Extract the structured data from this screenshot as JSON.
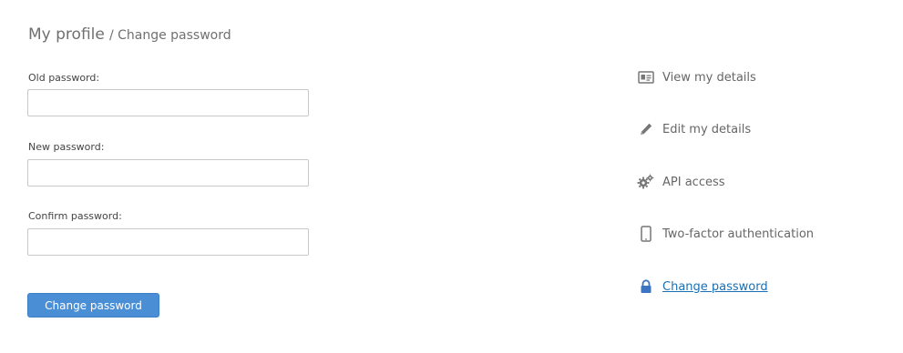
{
  "header": {
    "title": "My profile",
    "subtitle": "/ Change password"
  },
  "form": {
    "fields": [
      {
        "label": "Old password:",
        "value": "",
        "placeholder": ""
      },
      {
        "label": "New password:",
        "value": "",
        "placeholder": ""
      },
      {
        "label": "Confirm password:",
        "value": "",
        "placeholder": ""
      }
    ],
    "submit_label": "Change password",
    "submit_color": "#4a8fd6"
  },
  "sidebar": {
    "items": [
      {
        "label": "View my details",
        "icon": "id-card-icon",
        "active": false
      },
      {
        "label": "Edit my details",
        "icon": "pencil-icon",
        "active": false
      },
      {
        "label": "API access",
        "icon": "gears-icon",
        "active": false
      },
      {
        "label": "Two-factor authentication",
        "icon": "mobile-phone-icon",
        "active": false
      },
      {
        "label": "Change password",
        "icon": "lock-icon",
        "active": true
      }
    ],
    "active_color": "#1a6fb5"
  }
}
